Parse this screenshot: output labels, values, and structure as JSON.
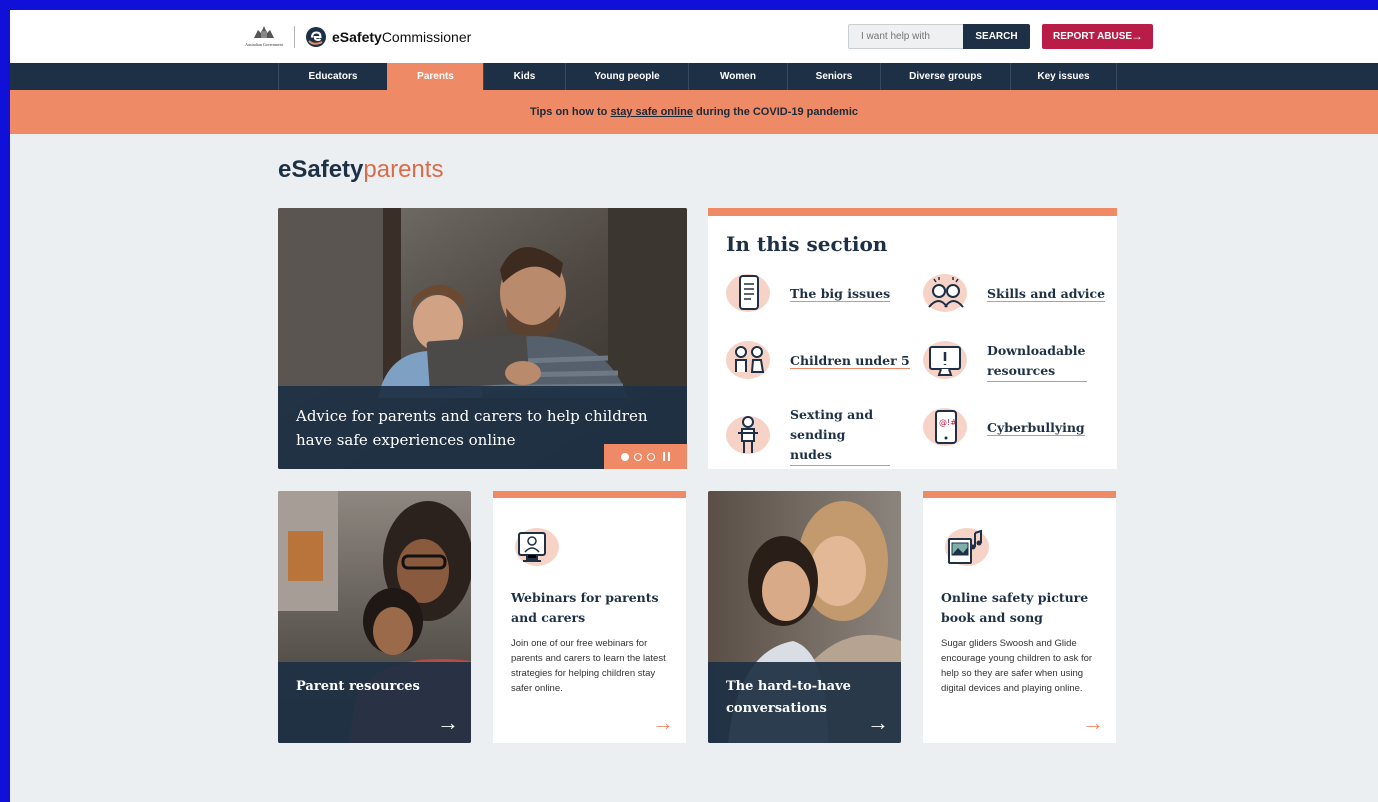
{
  "header": {
    "gov_logo_text": "Australian Government",
    "brand_bold": "eSafety",
    "brand_light": "Commissioner",
    "search_placeholder": "I want help with",
    "search_button": "SEARCH",
    "report_button": "REPORT ABUSE",
    "report_arrow_icon": "arrow-right-icon"
  },
  "nav": {
    "items": [
      {
        "label": "Educators",
        "active": false
      },
      {
        "label": "Parents",
        "active": true
      },
      {
        "label": "Kids",
        "active": false
      },
      {
        "label": "Young people",
        "active": false
      },
      {
        "label": "Women",
        "active": false
      },
      {
        "label": "Seniors",
        "active": false
      },
      {
        "label": "Diverse groups",
        "active": false
      },
      {
        "label": "Key issues",
        "active": false
      }
    ]
  },
  "banner": {
    "prefix": "Tips on how to ",
    "link": "stay safe online",
    "suffix": " during the COVID-19 pandemic"
  },
  "page": {
    "title_bold": "eSafety",
    "title_light": "parents"
  },
  "hero": {
    "caption": "Advice for parents and carers to help children have safe experiences online",
    "slides": 3,
    "active_slide": 1
  },
  "in_this_section": {
    "title": "In this section",
    "links": [
      {
        "label": "The big issues",
        "icon": "phone-list-icon"
      },
      {
        "label": "Skills and advice",
        "icon": "people-ideas-icon"
      },
      {
        "label": "Children under 5",
        "icon": "children-icon"
      },
      {
        "label": "Downloadable resources",
        "icon": "monitor-alert-icon"
      },
      {
        "label": "Sexting and sending nudes",
        "icon": "person-phone-icon"
      },
      {
        "label": "Cyberbullying",
        "icon": "phone-symbols-icon"
      }
    ]
  },
  "cards": [
    {
      "type": "image",
      "title": "Parent resources"
    },
    {
      "type": "text",
      "title": "Webinars for parents and carers",
      "description": "Join one of our free webinars for parents and carers to learn the latest strategies for helping children stay safer online.",
      "icon": "webinar-icon"
    },
    {
      "type": "image",
      "title": "The hard-to-have conversations"
    },
    {
      "type": "text",
      "title": "Online safety picture book and song",
      "description": "Sugar gliders Swoosh and Glide encourage young children to ask for help so they are safer when using digital devices and playing online.",
      "icon": "picture-book-icon"
    }
  ],
  "colors": {
    "navy": "#1e3045",
    "coral": "#ee8a66",
    "report": "#b91d47",
    "background": "#eceff1"
  }
}
